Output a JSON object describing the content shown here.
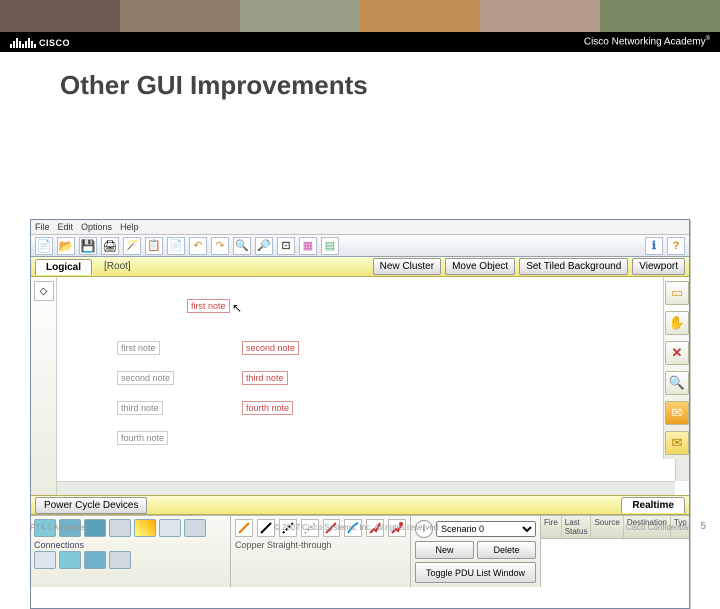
{
  "slide": {
    "title": "Other GUI Improvements",
    "academy": "Cisco Networking Academy",
    "footer_left": "PT4.1 Advanced",
    "footer_mid": "© 2007 Cisco Systems, Inc. All rights reserved.",
    "footer_right": "Cisco Confidential",
    "page": "5",
    "logo_text": "CISCO"
  },
  "menu": {
    "file": "File",
    "edit": "Edit",
    "options": "Options",
    "help": "Help"
  },
  "modebar": {
    "logical": "Logical",
    "root": "[Root]",
    "new_cluster": "New Cluster",
    "move_object": "Move Object",
    "set_bg": "Set Tiled Background",
    "viewport": "Viewport"
  },
  "notes": {
    "first_r": "first note",
    "second_r": "second note",
    "third_r": "third note",
    "fourth_r": "fourth note",
    "first_p": "first note",
    "second_p": "second note",
    "third_p": "third note",
    "fourth_p": "fourth note"
  },
  "rtbar": {
    "pcd": "Power Cycle Devices",
    "realtime": "Realtime"
  },
  "devices": {
    "connections": "Connections"
  },
  "conn": {
    "desc": "Copper Straight-through"
  },
  "sim": {
    "scenario": "Scenario 0",
    "new": "New",
    "delete": "Delete",
    "toggle": "Toggle PDU List Window"
  },
  "pdu": {
    "fire": "Fire",
    "last": "Last Status",
    "src": "Source",
    "dst": "Destination",
    "typ": "Typ"
  }
}
